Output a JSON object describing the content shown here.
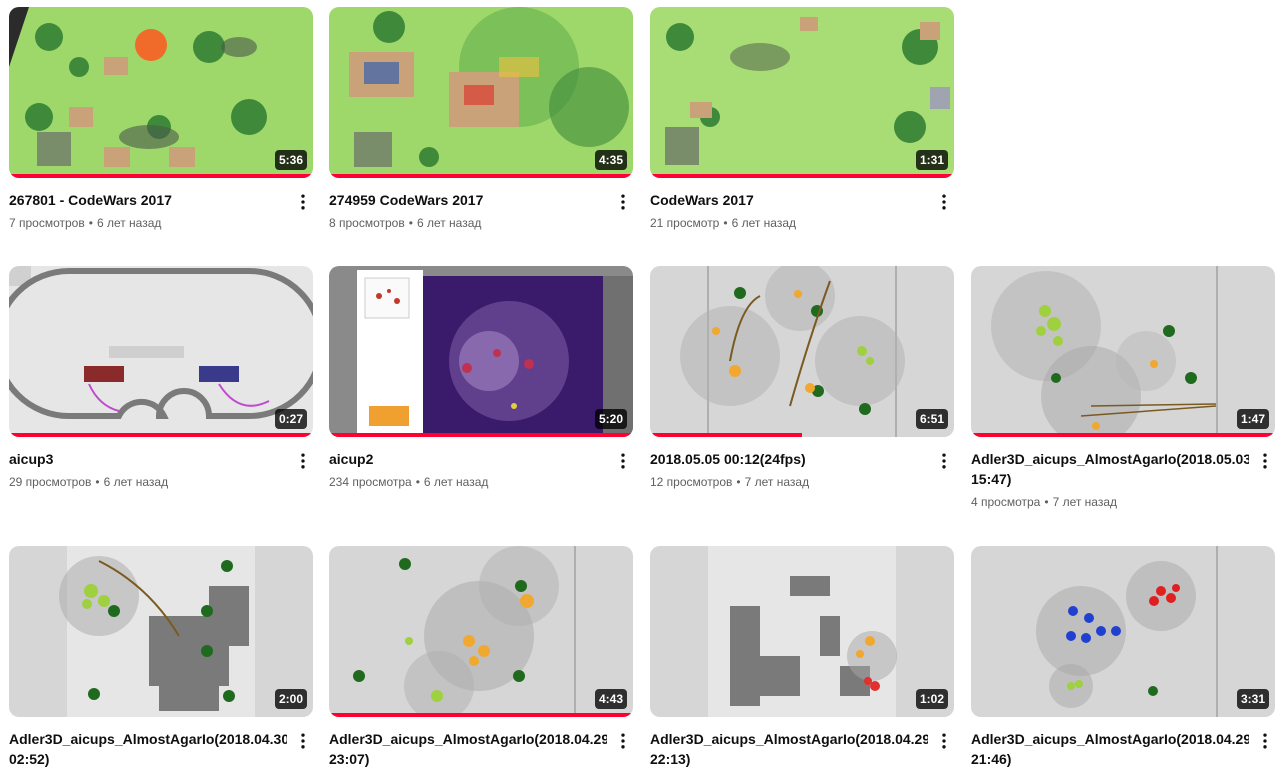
{
  "videos": [
    {
      "title": "267801 - CodeWars 2017",
      "views": "7 просмотров",
      "age": "6 лет назад",
      "duration": "5:36",
      "progress": 1.0,
      "thumb_kind": "codewars"
    },
    {
      "title": "274959 CodeWars 2017",
      "views": "8 просмотров",
      "age": "6 лет назад",
      "duration": "4:35",
      "progress": 1.0,
      "thumb_kind": "codewars"
    },
    {
      "title": "CodeWars 2017",
      "views": "21 просмотр",
      "age": "6 лет назад",
      "duration": "1:31",
      "progress": 1.0,
      "thumb_kind": "codewars"
    },
    {
      "title": "aicup3",
      "views": "29 просмотров",
      "age": "6 лет назад",
      "duration": "0:27",
      "progress": 1.0,
      "thumb_kind": "track"
    },
    {
      "title": "aicup2",
      "views": "234 просмотра",
      "age": "6 лет назад",
      "duration": "5:20",
      "progress": 1.0,
      "thumb_kind": "purple"
    },
    {
      "title": "2018.05.05 00:12(24fps)",
      "views": "12 просмотров",
      "age": "7 лет назад",
      "duration": "6:51",
      "progress": 0.5,
      "thumb_kind": "agario"
    },
    {
      "title": "Adler3D_aicups_AlmostAgarIo(2018.05.03 15:47)",
      "views": "4 просмотра",
      "age": "7 лет назад",
      "duration": "1:47",
      "progress": 1.0,
      "thumb_kind": "agario"
    },
    {
      "title": "Adler3D_aicups_AlmostAgarIo(2018.04.30 02:52)",
      "views": "",
      "age": "",
      "duration": "2:00",
      "progress": 0,
      "thumb_kind": "agario-map"
    },
    {
      "title": "Adler3D_aicups_AlmostAgarIo(2018.04.29 23:07)",
      "views": "",
      "age": "",
      "duration": "4:43",
      "progress": 1.0,
      "thumb_kind": "agario"
    },
    {
      "title": "Adler3D_aicups_AlmostAgarIo(2018.04.29 22:13)",
      "views": "",
      "age": "",
      "duration": "1:02",
      "progress": 0,
      "thumb_kind": "agario-map"
    },
    {
      "title": "Adler3D_aicups_AlmostAgarIo(2018.04.29 21:46)",
      "views": "",
      "age": "",
      "duration": "3:31",
      "progress": 0,
      "thumb_kind": "agario-blue"
    }
  ],
  "colors": {
    "progress": "#ff0033",
    "meta_text": "#606060",
    "title_text": "#0f0f0f"
  },
  "icons": {
    "menu": "more-vert-icon"
  }
}
